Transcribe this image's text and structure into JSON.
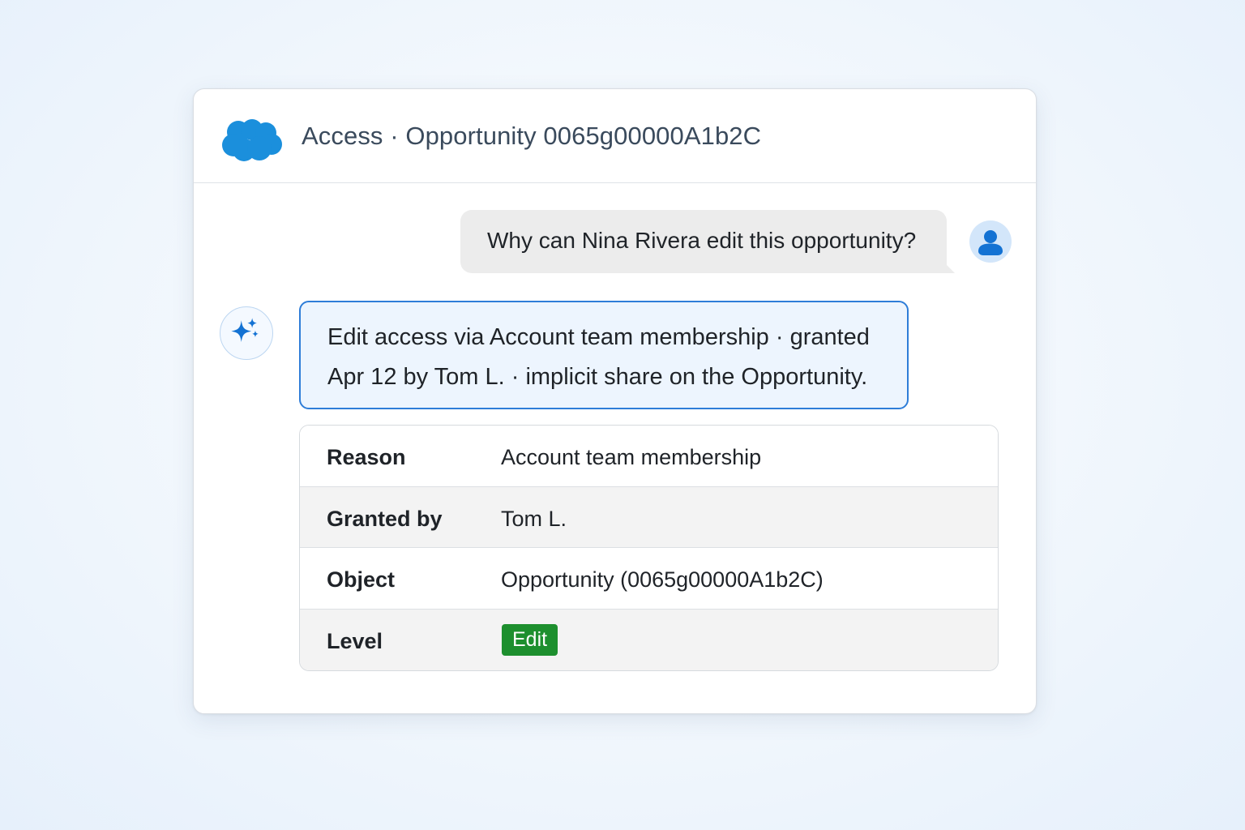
{
  "header": {
    "title": "Access · Opportunity 0065g00000A1b2C",
    "logo_icon": "salesforce-cloud-icon"
  },
  "chat": {
    "user_message": "Why can Nina Rivera edit this opportunity?",
    "user_avatar_icon": "user-icon",
    "assistant_avatar_icon": "sparkle-icon",
    "assistant_message": {
      "line1": "Edit access via Account team membership · granted",
      "line2": "Apr 12 by Tom L. · implicit share on the Opportunity."
    }
  },
  "details": {
    "rows": [
      {
        "label": "Reason",
        "value": "Account team membership"
      },
      {
        "label": "Granted by",
        "value": "Tom L."
      },
      {
        "label": "Object",
        "value": "Opportunity (0065g00000A1b2C)"
      },
      {
        "label": "Level",
        "value": "Edit"
      }
    ]
  },
  "colors": {
    "brand": "#1b8fdc",
    "accent_border": "#2e7dd8",
    "badge_green": "#1d8f2e"
  }
}
